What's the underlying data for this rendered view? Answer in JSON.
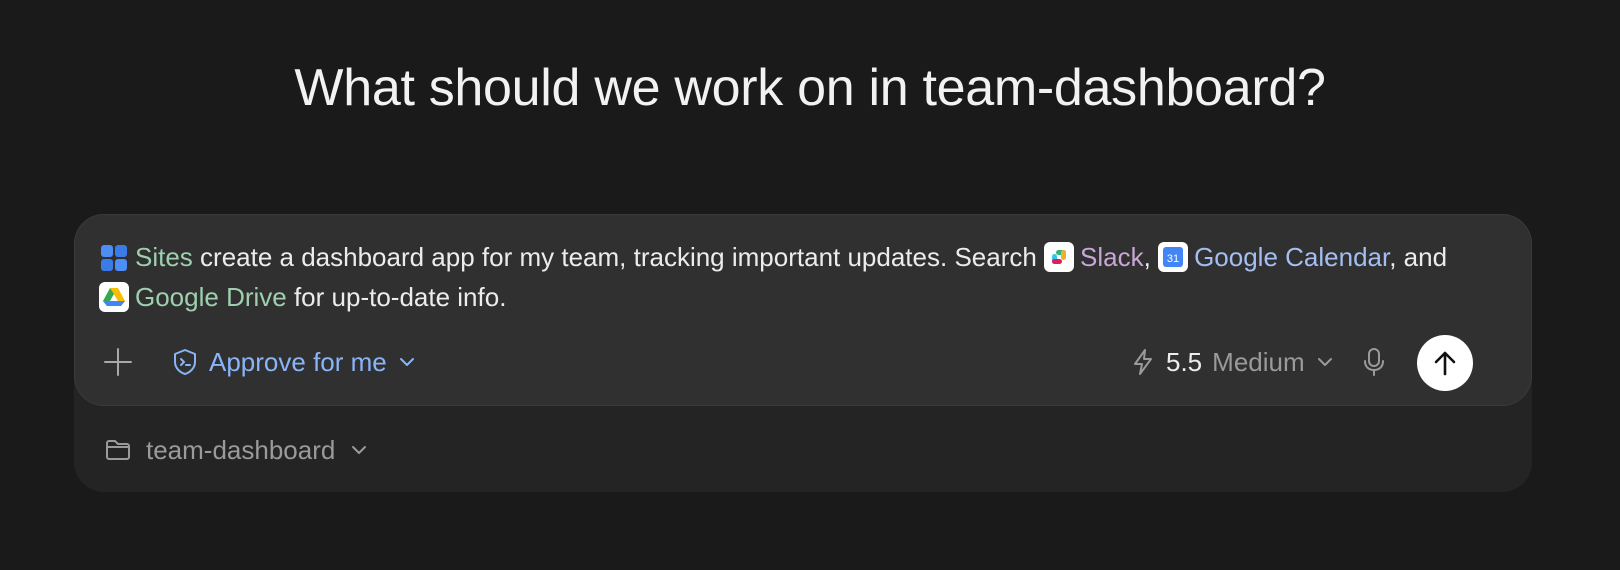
{
  "heading": "What should we work on in team-dashboard?",
  "prompt": {
    "sites_label": "Sites",
    "text_1": " create a dashboard app for my team, tracking important updates. Search ",
    "slack_label": "Slack",
    "text_2": ", ",
    "gcal_label": "Google Calendar",
    "text_3": ", and ",
    "gdrive_label": "Google Drive",
    "text_4": " for up-to-date info.",
    "gcal_icon_text": "31"
  },
  "toolbar": {
    "approve_label": "Approve for me",
    "model_version": "5.5",
    "model_level": "Medium"
  },
  "project": {
    "folder_label": "team-dashboard"
  },
  "colors": {
    "background": "#1a1a1a",
    "composer": "#303030",
    "accent_blue": "#8ab4f8",
    "sites_green": "#9ecfae",
    "slack_purple": "#c9a6d6",
    "gcal_blue": "#a4bef2"
  },
  "icons": [
    "plus-icon",
    "shield-icon",
    "chevron-down-icon",
    "lightning-icon",
    "microphone-icon",
    "arrow-up-icon",
    "folder-icon",
    "sites-icon",
    "slack-icon",
    "google-calendar-icon",
    "google-drive-icon"
  ]
}
